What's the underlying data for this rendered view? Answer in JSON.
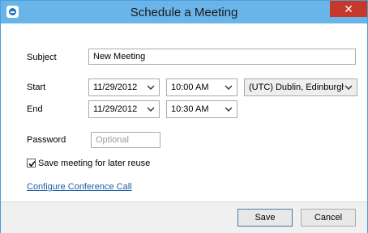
{
  "window": {
    "title": "Schedule a Meeting",
    "close_glyph": "✕",
    "app_icon": "meeting-app-icon"
  },
  "form": {
    "subject": {
      "label": "Subject",
      "value": "New Meeting"
    },
    "start": {
      "label": "Start",
      "date": "11/29/2012",
      "time": "10:00 AM",
      "timezone": "(UTC) Dublin, Edinburgh,"
    },
    "end": {
      "label": "End",
      "date": "11/29/2012",
      "time": "10:30 AM"
    },
    "password": {
      "label": "Password",
      "placeholder": "Optional"
    },
    "save_for_reuse": {
      "label": "Save meeting for later reuse",
      "checked": true
    },
    "configure_link": "Configure Conference Call"
  },
  "buttons": {
    "save": "Save",
    "cancel": "Cancel"
  },
  "colors": {
    "titlebar": "#69b4e8",
    "close": "#c7372b",
    "link": "#1f5fa8"
  }
}
